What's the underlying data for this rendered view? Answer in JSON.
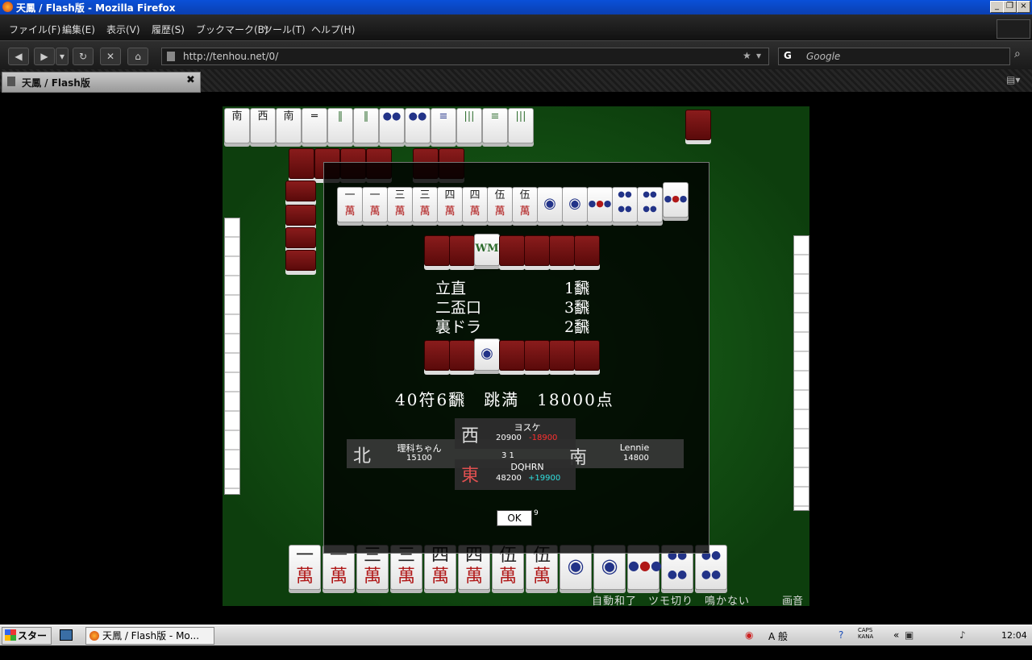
{
  "window": {
    "title": "天鳳 / Flash版 - Mozilla Firefox"
  },
  "menu": [
    {
      "label": "ファイル(F)"
    },
    {
      "label": "編集(E)"
    },
    {
      "label": "表示(V)"
    },
    {
      "label": "履歴(S)"
    },
    {
      "label": "ブックマーク(B)"
    },
    {
      "label": "ツール(T)"
    },
    {
      "label": "ヘルプ(H)"
    }
  ],
  "nav": {
    "url": "http://tenhou.net/0/",
    "search_placeholder": "Google"
  },
  "tab": {
    "title": "天鳳 / Flash版"
  },
  "game": {
    "yaku": [
      {
        "name": "立直",
        "han": "1飜"
      },
      {
        "name": "二盃口",
        "han": "3飜"
      },
      {
        "name": "裏ドラ",
        "han": "2飜"
      }
    ],
    "score_line": "40符6飜　跳満　18000点",
    "players": {
      "west": {
        "wind": "西",
        "name": "ヨスケ",
        "points": "20900",
        "delta": "-18900"
      },
      "east": {
        "wind": "東",
        "name": "DQHRN",
        "points": "48200",
        "delta": "+19900"
      },
      "north": {
        "wind": "北",
        "name": "理科ちゃん",
        "points": "15100"
      },
      "south": {
        "wind": "南",
        "name": "Lennie",
        "points": "14800"
      }
    },
    "center_counts": "3  1",
    "ok_label": "OK",
    "ok_timer": "9",
    "options": "自動和了　ツモ切り　鳴かない",
    "gasyo": "画音",
    "colors": {
      "loss": "#ff3030",
      "gain": "#30e0e0",
      "felt": "#1c6a1c",
      "tile_back": "#7a1414"
    }
  },
  "taskbar": {
    "start_label": "スタート",
    "task_item": "天鳳 / Flash版 - Mo...",
    "ime": "A 般",
    "caps": "CAPS KANA",
    "clock": "12:04"
  }
}
